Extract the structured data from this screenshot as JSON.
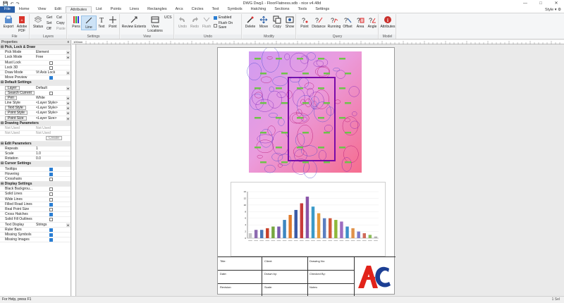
{
  "window": {
    "title": "DWG Dwg1 - FloorFlatness.sdb - nice v4.48d",
    "qat_icons": [
      "save-icon",
      "undo-icon",
      "redo-icon"
    ]
  },
  "tabs": [
    "File",
    "Home",
    "View",
    "Edit",
    "Attributes",
    "List",
    "Points",
    "Lines",
    "Rectangles",
    "Arcs",
    "Circles",
    "Text",
    "Symbols",
    "Hatching",
    "Sections",
    "Tools",
    "Settings"
  ],
  "active_tab": "Attributes",
  "style_label": "Style",
  "ribbon": {
    "groups": {
      "file": "File",
      "layers": "Layers",
      "settings": "Settings",
      "view": "View",
      "undo": "Undo",
      "modify": "Modify",
      "query": "Query",
      "model": "Model"
    },
    "file": {
      "export": "Export",
      "adobe_pdf": "Adobe\nPDF"
    },
    "layers": {
      "status": "Status",
      "get": "Get",
      "cut": "Cut",
      "set": "Set",
      "copy": "Copy",
      "off": "Off",
      "paste": "Paste"
    },
    "settings": {
      "pens": "Pens",
      "line": "Line",
      "text": "Text",
      "point": "Point"
    },
    "view": {
      "review_extents": "Review Extents",
      "view_locations": "View\nLocations",
      "ucs": "UCS"
    },
    "undo": {
      "undo": "Undo",
      "redo": "Redo",
      "flush": "Flush",
      "enabled": "Enabled",
      "flush_on_save": "Flush On Save"
    },
    "modify": {
      "delete": "Delete",
      "move": "Move",
      "copy": "Copy",
      "show": "Show"
    },
    "query": {
      "point": "Point",
      "distance": "Distance",
      "running": "Running",
      "offset": "Offset",
      "area": "Area",
      "angle": "Angle"
    },
    "model": {
      "attributes": "Attributes"
    }
  },
  "properties": {
    "title": "Properties",
    "close": "x",
    "sections": [
      {
        "name": "Pick, Lock & Draw",
        "rows": [
          {
            "name": "Pick Mode",
            "value": "Element",
            "kind": "dd"
          },
          {
            "name": "Lock Mode",
            "value": "Free",
            "kind": "dd"
          },
          {
            "name": "Must Lock",
            "value": "",
            "kind": "chk",
            "on": false
          },
          {
            "name": "Lock 3D",
            "value": "",
            "kind": "chk",
            "on": false
          },
          {
            "name": "Draw Mode",
            "value": "Vt Axis Lock",
            "kind": "dd"
          },
          {
            "name": "Move Preview",
            "value": "",
            "kind": "chk",
            "on": true
          }
        ]
      },
      {
        "name": "Default Settings",
        "rows": [
          {
            "name": "Layer",
            "value": "Default",
            "kind": "dd",
            "btn": true
          },
          {
            "name": "Search Current",
            "value": "",
            "kind": "chk",
            "on": false,
            "btn": true
          },
          {
            "name": "Pen",
            "value": "White",
            "kind": "dd",
            "btn": true
          },
          {
            "name": "Line Style",
            "value": "<Layer Style>",
            "kind": "dd"
          },
          {
            "name": "Text Style",
            "value": "<Layer Style>",
            "kind": "dd",
            "btn": true
          },
          {
            "name": "Point Style",
            "value": "<Layer Style>",
            "kind": "dd",
            "btn": true
          },
          {
            "name": "Point Size",
            "value": "<Layer Size>",
            "kind": "dd",
            "btn": true
          }
        ]
      },
      {
        "name": "Drawing Parameters",
        "rows": [
          {
            "name": "Not Used",
            "value": "Not Used",
            "kind": "text",
            "dis": true
          },
          {
            "name": "Not Used",
            "value": "Not Used",
            "kind": "text",
            "dis": true
          },
          {
            "name": "",
            "value": "Create",
            "kind": "create"
          }
        ]
      },
      {
        "name": "Edit Parameters",
        "rows": [
          {
            "name": "Repeats",
            "value": "1",
            "kind": "text"
          },
          {
            "name": "Scale",
            "value": "1.0",
            "kind": "text"
          },
          {
            "name": "Rotation",
            "value": "0.0",
            "kind": "text"
          }
        ]
      },
      {
        "name": "Cursor Settings",
        "rows": [
          {
            "name": "Tooltips",
            "value": "",
            "kind": "chk",
            "on": true
          },
          {
            "name": "Hovering",
            "value": "",
            "kind": "chk",
            "on": true
          },
          {
            "name": "Crosshairs",
            "value": "",
            "kind": "chk",
            "on": false
          }
        ]
      },
      {
        "name": "Display Settings",
        "rows": [
          {
            "name": "Black Backgrou...",
            "value": "",
            "kind": "chk",
            "on": false
          },
          {
            "name": "Solid Lines",
            "value": "",
            "kind": "chk",
            "on": false
          },
          {
            "name": "Wide Lines",
            "value": "",
            "kind": "chk",
            "on": false
          },
          {
            "name": "Filled Road Lines",
            "value": "",
            "kind": "chk",
            "on": true
          },
          {
            "name": "Real Point Size",
            "value": "",
            "kind": "chk",
            "on": false
          },
          {
            "name": "Cross Hatches",
            "value": "",
            "kind": "chk",
            "on": true
          },
          {
            "name": "Solid Fill Outlines",
            "value": "",
            "kind": "chk",
            "on": false
          },
          {
            "name": "Text Display",
            "value": "Strings",
            "kind": "dd"
          },
          {
            "name": "Ruler Bars",
            "value": "",
            "kind": "chk",
            "on": true
          },
          {
            "name": "Missing Symbols",
            "value": "",
            "kind": "chk",
            "on": true
          },
          {
            "name": "Missing Images",
            "value": "",
            "kind": "chk",
            "on": true
          }
        ]
      }
    ]
  },
  "ruler": {
    "unit": "100mm"
  },
  "chart_data": {
    "type": "bar",
    "title": "",
    "categories": [
      "",
      "",
      "",
      "",
      "",
      "",
      "",
      "",
      "",
      "",
      "",
      "",
      "",
      "",
      "",
      "",
      "",
      "",
      "",
      "",
      "",
      "",
      ""
    ],
    "values": [
      1.5,
      2.5,
      2.5,
      3,
      3.5,
      3.5,
      5.5,
      7,
      8.5,
      10.5,
      12.5,
      9.5,
      7.5,
      6,
      6,
      5.5,
      5,
      3.5,
      3,
      2,
      1.5,
      1,
      0.5
    ],
    "colors": [
      "#c9c9c9",
      "#8e6bb0",
      "#4a76b6",
      "#c8402a",
      "#76a640",
      "#7a5bae",
      "#3c86c0",
      "#e07a2a",
      "#3a5aa6",
      "#c73b3b",
      "#8a54a8",
      "#3a9ac8",
      "#e49a3a",
      "#5b7ec0",
      "#d05a3a",
      "#8fb83a",
      "#9c6cc0",
      "#3c8ec8",
      "#e0924a",
      "#7a7ac8",
      "#d06a5a",
      "#8cbc5a",
      "#b0b0b0"
    ],
    "ylim": [
      0,
      14
    ],
    "yticks": [
      "0",
      "2",
      "4",
      "6",
      "8",
      "10",
      "12",
      "14"
    ]
  },
  "title_block": {
    "title": "Title:",
    "client": "Client:",
    "drawing_no": "Drawing No:",
    "date": "Date:",
    "drawn_by": "Drawn by:",
    "checked_by": "Checked By:",
    "revision": "Revision:",
    "scale": "Scale:",
    "notes": "Notes:",
    "logo_letters": "AtC",
    "logo_colors": {
      "red": "#e2231a",
      "blue": "#1c3f94"
    }
  },
  "status": {
    "help": "For Help, press F1",
    "right": "1 Sel"
  }
}
